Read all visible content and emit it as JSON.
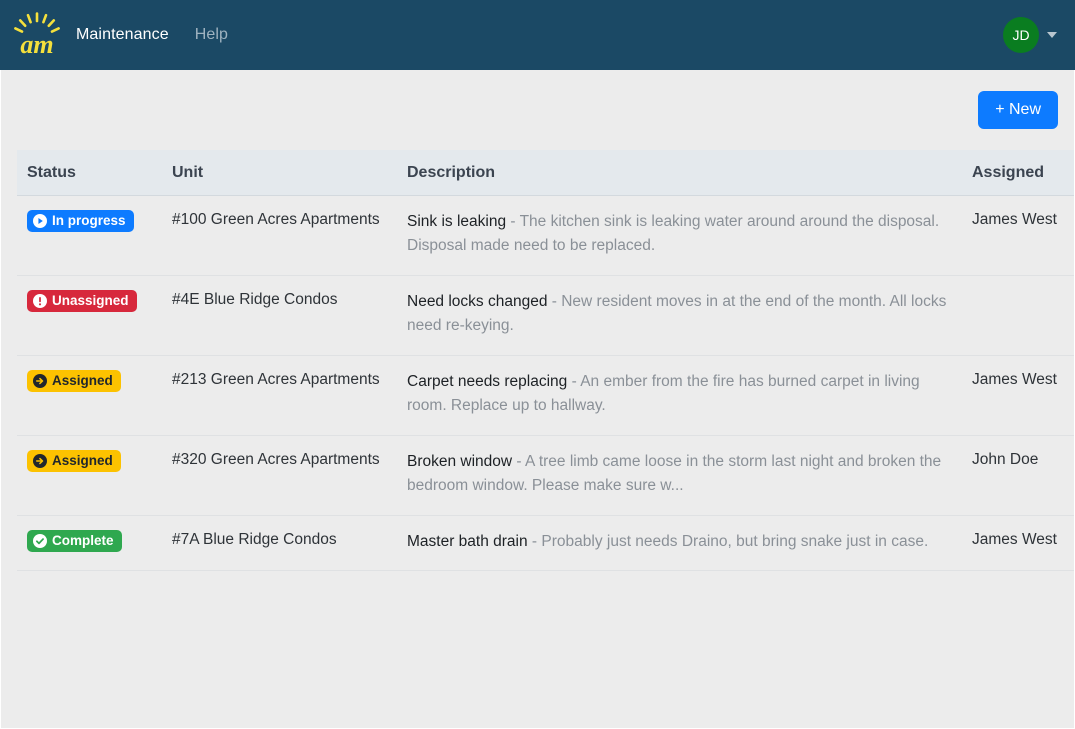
{
  "navbar": {
    "logo_text": "am",
    "logo_icon": "sun-rays-logo",
    "links": [
      {
        "label": "Maintenance",
        "active": true
      },
      {
        "label": "Help",
        "active": false
      }
    ],
    "avatar_initials": "JD",
    "avatar_color": "#0a7d20",
    "caret_icon": "chevron-down-icon",
    "background_color": "#1b4965"
  },
  "toolbar": {
    "new_label": "+ New",
    "new_color": "#0d7bff"
  },
  "table": {
    "columns": [
      "Status",
      "Unit",
      "Description",
      "Assigned"
    ],
    "rows": [
      {
        "status": {
          "label": "In progress",
          "style": "blue",
          "icon": "play-circle-icon",
          "color": "#0d7bff"
        },
        "unit": "#100 Green Acres Apartments",
        "desc_title": "Sink is leaking",
        "desc_body": " - The kitchen sink is leaking water around around the disposal. Disposal made need to be replaced.",
        "assigned": "James West"
      },
      {
        "status": {
          "label": "Unassigned",
          "style": "red",
          "icon": "exclamation-circle-icon",
          "color": "#d7283c"
        },
        "unit": "#4E Blue Ridge Condos",
        "desc_title": "Need locks changed",
        "desc_body": " - New resident moves in at the end of the month. All locks need re-keying.",
        "assigned": ""
      },
      {
        "status": {
          "label": "Assigned",
          "style": "yellow",
          "icon": "arrow-right-circle-icon",
          "color": "#fcc200"
        },
        "unit": "#213 Green Acres Apartments",
        "desc_title": "Carpet needs replacing",
        "desc_body": " - An ember from the fire has burned carpet in living room. Replace up to hallway.",
        "assigned": "James West"
      },
      {
        "status": {
          "label": "Assigned",
          "style": "yellow",
          "icon": "arrow-right-circle-icon",
          "color": "#fcc200"
        },
        "unit": "#320 Green Acres Apartments",
        "desc_title": "Broken window",
        "desc_body": " - A tree limb came loose in the storm last night and broken the bedroom window. Please make sure w...",
        "assigned": "John Doe"
      },
      {
        "status": {
          "label": "Complete",
          "style": "green",
          "icon": "check-circle-icon",
          "color": "#2fa84f"
        },
        "unit": "#7A Blue Ridge Condos",
        "desc_title": "Master bath drain",
        "desc_body": " - Probably just needs Draino, but bring snake just in case.",
        "assigned": "James West"
      }
    ]
  }
}
